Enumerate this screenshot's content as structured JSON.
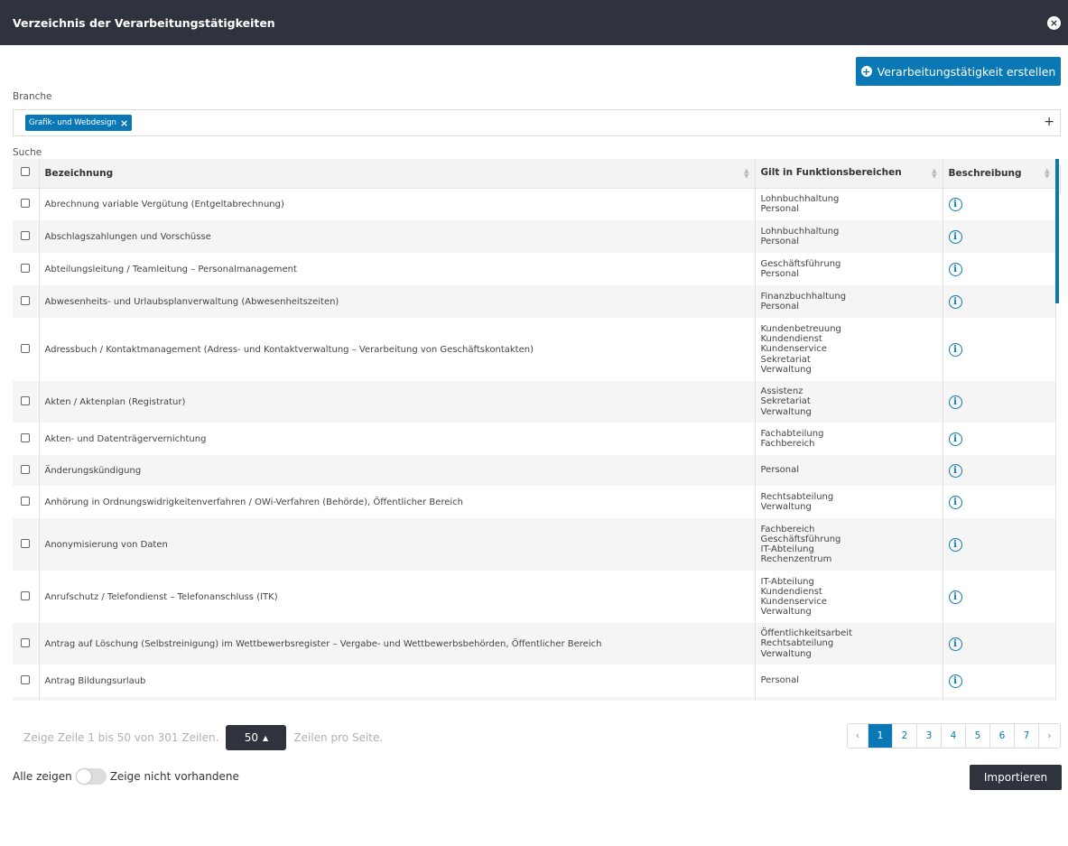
{
  "modal": {
    "title": "Verzeichnis der Verarbeitungstätigkeiten",
    "close_icon": "×"
  },
  "create_button": {
    "label": "Verarbeitungstätigkeit erstellen",
    "icon": "plus-circle-icon"
  },
  "branche": {
    "label": "Branche",
    "tag": "Grafik- und Webdesign",
    "add_icon": "+"
  },
  "search": {
    "label": "Suche",
    "value": "",
    "placeholder": ""
  },
  "table": {
    "columns": [
      "Bezeichnung",
      "Gilt in Funktionsbereichen",
      "Beschreibung"
    ],
    "rows": [
      {
        "name": "Abrechnung variable Vergütung (Entgeltabrechnung)",
        "func": [
          "Lohnbuchhaltung",
          "Personal"
        ],
        "h": 36
      },
      {
        "name": "Abschlagszahlungen und Vorschüsse",
        "func": [
          "Lohnbuchhaltung",
          "Personal"
        ],
        "h": 36
      },
      {
        "name": "Abteilungsleitung / Teamleitung – Personalmanagement",
        "func": [
          "Geschäftsführung",
          "Personal"
        ],
        "h": 36
      },
      {
        "name": "Abwesenheits- und Urlaubsplanverwaltung (Abwesenheitszeiten)",
        "func": [
          "Finanzbuchhaltung",
          "Personal"
        ],
        "h": 36
      },
      {
        "name": "Adressbuch / Kontaktmanagement (Adress- und Kontaktverwaltung – Verarbeitung von Geschäftskontakten)",
        "func": [
          "Kundenbetreuung",
          "Kundendienst",
          "Kundenservice",
          "Sekretariat",
          "Verwaltung"
        ],
        "h": 70
      },
      {
        "name": "Akten / Aktenplan (Registratur)",
        "func": [
          "Assistenz",
          "Sekretariat",
          "Verwaltung"
        ],
        "h": 46
      },
      {
        "name": "Akten- und Datenträgervernichtung",
        "func": [
          "Fachabteilung",
          "Fachbereich"
        ],
        "h": 36
      },
      {
        "name": "Änderungskündigung",
        "func": [
          "Personal"
        ],
        "h": 34
      },
      {
        "name": "Anhörung in Ordnungswidrigkeitenverfahren / OWi-Verfahren (Behörde), Öffentlicher Bereich",
        "func": [
          "Rechtsabteilung",
          "Verwaltung"
        ],
        "h": 36
      },
      {
        "name": "Anonymisierung von Daten",
        "func": [
          "Fachbereich",
          "Geschäftsführung",
          "IT-Abteilung",
          "Rechenzentrum"
        ],
        "h": 58
      },
      {
        "name": "Anrufschutz / Telefondienst – Telefonanschluss (ITK)",
        "func": [
          "IT-Abteilung",
          "Kundendienst",
          "Kundenservice",
          "Verwaltung"
        ],
        "h": 58
      },
      {
        "name": "Antrag auf Löschung (Selbstreinigung) im Wettbewerbsregister – Vergabe- und Wettbewerbsbehörden, Öffentlicher Bereich",
        "func": [
          "Öffentlichkeitsarbeit",
          "Rechtsabteilung",
          "Verwaltung"
        ],
        "h": 46
      },
      {
        "name": "Antrag Bildungsurlaub",
        "func": [
          "Personal"
        ],
        "h": 36
      },
      {
        "name": "",
        "func": [
          ""
        ],
        "h": 30
      }
    ]
  },
  "footer": {
    "info_prefix": "Zeige Zeile 1 bis 50 von 301 Zeilen.",
    "per_page": "50",
    "info_suffix": "Zeilen pro Seite.",
    "pages": [
      "‹",
      "1",
      "2",
      "3",
      "4",
      "5",
      "6",
      "7",
      "›"
    ],
    "active_page": "1",
    "toggle_left": "Alle zeigen",
    "toggle_right": "Zeige nicht vorhandene",
    "import_label": "Importieren"
  },
  "colors": {
    "header_bg": "#2f333d",
    "accent": "#0a78b5"
  }
}
